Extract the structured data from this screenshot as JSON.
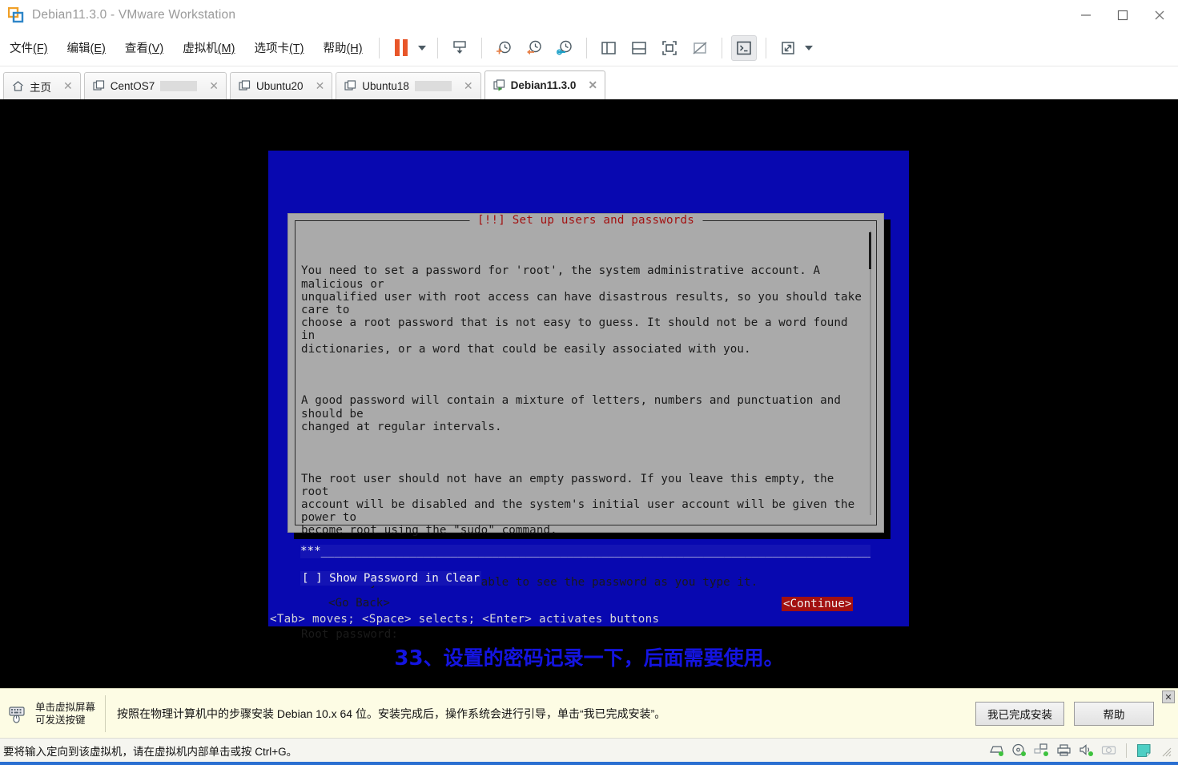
{
  "window": {
    "title": "Debian11.3.0 - VMware Workstation",
    "logo_icon": "vmware-logo-icon",
    "controls": [
      {
        "name": "minimize-button",
        "icon": "minimize-icon"
      },
      {
        "name": "maximize-button",
        "icon": "maximize-icon"
      },
      {
        "name": "close-button",
        "icon": "close-icon"
      }
    ]
  },
  "menubar": {
    "items": [
      {
        "label": "文件",
        "accel": "(F)"
      },
      {
        "label": "编辑",
        "accel": "(E)"
      },
      {
        "label": "查看",
        "accel": "(V)"
      },
      {
        "label": "虚拟机",
        "accel": "(M)"
      },
      {
        "label": "选项卡",
        "accel": "(T)"
      },
      {
        "label": "帮助",
        "accel": "(H)"
      }
    ],
    "toolbar": [
      {
        "name": "suspend-button",
        "icon": "pause-icon"
      },
      {
        "name": "power-dropdown-button",
        "icon": "chevron-down-icon"
      },
      {
        "name": "send-ctrl-alt-del-button",
        "icon": "snapshot-save-icon"
      },
      {
        "name": "take-snapshot-button",
        "icon": "clock-plus-icon"
      },
      {
        "name": "revert-snapshot-button",
        "icon": "clock-back-icon"
      },
      {
        "name": "snapshot-manager-button",
        "icon": "clock-wrench-icon"
      },
      {
        "name": "show-library-button",
        "icon": "panel-left-icon"
      },
      {
        "name": "show-thumbnail-bar-button",
        "icon": "panel-bottom-icon"
      },
      {
        "name": "show-console-view-button",
        "icon": "fullscreen-frame-icon"
      },
      {
        "name": "hide-console-view-button",
        "icon": "frame-off-icon"
      },
      {
        "name": "unity-mode-button",
        "icon": "terminal-icon"
      },
      {
        "name": "enter-fullscreen-button",
        "icon": "expand-arrows-icon"
      },
      {
        "name": "fullscreen-dropdown-button",
        "icon": "chevron-down-icon"
      }
    ]
  },
  "tabs": [
    {
      "label": "主页",
      "icon": "home-icon",
      "active": false,
      "closable": true,
      "progress": false
    },
    {
      "label": "CentOS7",
      "icon": "vm-icon",
      "active": false,
      "closable": true,
      "progress": true
    },
    {
      "label": "Ubuntu20",
      "icon": "vm-icon",
      "active": false,
      "closable": true,
      "progress": false
    },
    {
      "label": "Ubuntu18",
      "icon": "vm-icon",
      "active": false,
      "closable": true,
      "progress": true
    },
    {
      "label": "Debian11.3.0",
      "icon": "vm-running-icon",
      "active": true,
      "closable": true,
      "progress": false
    }
  ],
  "installer": {
    "title": "[!!] Set up users and passwords",
    "paragraphs": [
      "You need to set a password for 'root', the system administrative account. A malicious or\nunqualified user with root access can have disastrous results, so you should take care to\nchoose a root password that is not easy to guess. It should not be a word found in\ndictionaries, or a word that could be easily associated with you.",
      "A good password will contain a mixture of letters, numbers and punctuation and should be\nchanged at regular intervals.",
      "The root user should not have an empty password. If you leave this empty, the root\naccount will be disabled and the system's initial user account will be given the power to\nbecome root using the \"sudo\" command.",
      "Note that you will not be able to see the password as you type it.",
      "Root password:"
    ],
    "password_value": "***______________________________________________________________________________________",
    "show_password_label": "[ ] Show Password in Clear",
    "go_back_label": "<Go Back>",
    "continue_label": "<Continue>",
    "hint": "<Tab> moves; <Space> selects; <Enter> activates buttons",
    "colors": {
      "screen_blue": "#0808b0",
      "dialog_grey": "#aaaaaa",
      "title_red": "#a21010",
      "field_blue": "#1414b4",
      "continue_red": "#a21010"
    }
  },
  "caption": {
    "number": "33",
    "text": "、设置的密码记录一下，后面需要使用。",
    "color": "#1414e0"
  },
  "notification": {
    "hint_icon": "keyboard-mouse-icon",
    "hint_line1": "单击虚拟屏幕",
    "hint_line2": "可发送按键",
    "message": "按照在物理计算机中的步骤安装 Debian 10.x 64 位。安装完成后，操作系统会进行引导，单击“我已完成安装”。",
    "buttons": [
      {
        "name": "installation-complete-button",
        "label": "我已完成安装"
      },
      {
        "name": "help-button",
        "label": "帮助"
      }
    ],
    "close_label": "✕"
  },
  "statusbar": {
    "message": "要将输入定向到该虚拟机，请在虚拟机内部单击或按 Ctrl+G。",
    "devices": [
      {
        "name": "hard-disk-icon",
        "icon": "hard-disk-icon"
      },
      {
        "name": "cd-dvd-icon",
        "icon": "cd-dvd-icon"
      },
      {
        "name": "network-adapter-icon",
        "icon": "network-adapter-icon"
      },
      {
        "name": "printer-icon",
        "icon": "printer-icon"
      },
      {
        "name": "sound-card-icon",
        "icon": "sound-card-icon"
      },
      {
        "name": "camera-icon",
        "icon": "camera-icon"
      }
    ],
    "notes_icon": "notes-icon",
    "grip_icon": "resize-grip-icon"
  }
}
